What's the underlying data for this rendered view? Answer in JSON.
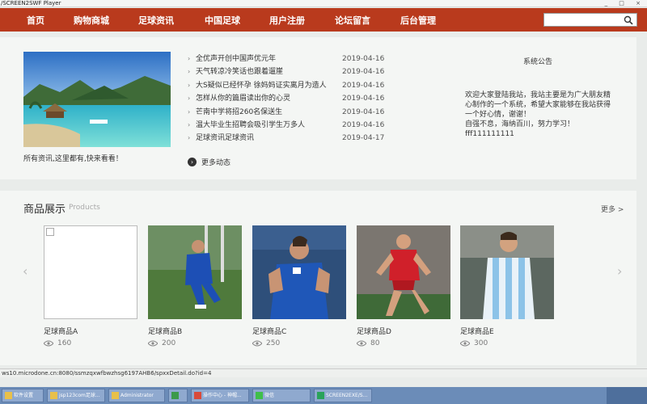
{
  "window": {
    "title": "/SCREEN2SWF Player",
    "buttons": "_ □ ×"
  },
  "nav": {
    "items": [
      "首页",
      "购物商城",
      "足球资讯",
      "中国足球",
      "用户注册",
      "论坛留言",
      "后台管理"
    ],
    "search_placeholder": ""
  },
  "banner": {
    "caption": "所有资讯,这里都有,快来看看！"
  },
  "news": [
    {
      "title": "全优声开创中国声优元年",
      "date": "2019-04-16"
    },
    {
      "title": "天气转凉冷笑话也跟着遛崖",
      "date": "2019-04-16"
    },
    {
      "title": "大S疑似已经怀孕 徐妈妈证实离月为造人",
      "date": "2019-04-16"
    },
    {
      "title": "怎样从你的篇眉读出你的心灵",
      "date": "2019-04-16"
    },
    {
      "title": "芒南中学将招260名保送生",
      "date": "2019-04-16"
    },
    {
      "title": "温大毕业生招聘会吸引学生万多人",
      "date": "2019-04-16"
    },
    {
      "title": "足球资讯足球资讯",
      "date": "2019-04-17"
    }
  ],
  "more_news": {
    "label": "更多动态",
    "icon": "chevron-right-icon"
  },
  "notice": {
    "title": "系统公告",
    "lines": [
      "欢迎大家登陆我站，我站主要是为广大朋友精",
      "心制作的一个系统，希望大家能够在我站获得",
      "一个好心情，谢谢！",
      "自强不息，海纳百川，努力学习！",
      "fff111111111"
    ]
  },
  "products_section": {
    "title": "商品展示",
    "subtitle": "Products",
    "more": "更多 >",
    "prev": "‹",
    "next": "›"
  },
  "products": [
    {
      "name": "足球商品A",
      "views": "160"
    },
    {
      "name": "足球商品B",
      "views": "200"
    },
    {
      "name": "足球商品C",
      "views": "250"
    },
    {
      "name": "足球商品D",
      "views": "80"
    },
    {
      "name": "足球商品E",
      "views": "300"
    }
  ],
  "statusbar": {
    "url": "ws10.microdone.cn:8080/ssmzqxwfbwzhsg6197AHB6/spxxDetail.do?id=4"
  },
  "taskbar": {
    "items": [
      "软件设置",
      "jsp123com足球...",
      "Administrator",
      "",
      "",
      "操作中心 - 神帽...",
      "微信",
      "SCREEN2EXE/S..."
    ]
  },
  "colors": {
    "nav_bg": "#b93a1d",
    "page_bg": "#e9ecea",
    "panel_bg": "#f4f6f4"
  }
}
